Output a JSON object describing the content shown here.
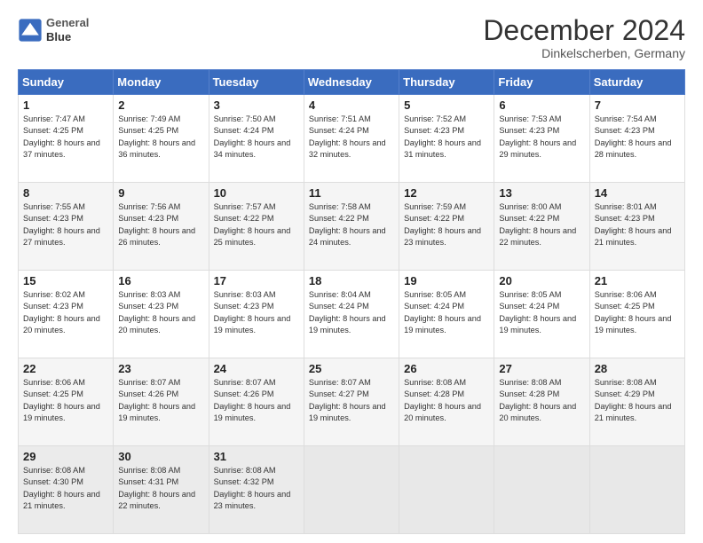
{
  "header": {
    "logo_line1": "General",
    "logo_line2": "Blue",
    "title": "December 2024",
    "subtitle": "Dinkelscherben, Germany"
  },
  "days_of_week": [
    "Sunday",
    "Monday",
    "Tuesday",
    "Wednesday",
    "Thursday",
    "Friday",
    "Saturday"
  ],
  "weeks": [
    [
      {
        "day": "1",
        "rise": "Sunrise: 7:47 AM",
        "set": "Sunset: 4:25 PM",
        "light": "Daylight: 8 hours and 37 minutes."
      },
      {
        "day": "2",
        "rise": "Sunrise: 7:49 AM",
        "set": "Sunset: 4:25 PM",
        "light": "Daylight: 8 hours and 36 minutes."
      },
      {
        "day": "3",
        "rise": "Sunrise: 7:50 AM",
        "set": "Sunset: 4:24 PM",
        "light": "Daylight: 8 hours and 34 minutes."
      },
      {
        "day": "4",
        "rise": "Sunrise: 7:51 AM",
        "set": "Sunset: 4:24 PM",
        "light": "Daylight: 8 hours and 32 minutes."
      },
      {
        "day": "5",
        "rise": "Sunrise: 7:52 AM",
        "set": "Sunset: 4:23 PM",
        "light": "Daylight: 8 hours and 31 minutes."
      },
      {
        "day": "6",
        "rise": "Sunrise: 7:53 AM",
        "set": "Sunset: 4:23 PM",
        "light": "Daylight: 8 hours and 29 minutes."
      },
      {
        "day": "7",
        "rise": "Sunrise: 7:54 AM",
        "set": "Sunset: 4:23 PM",
        "light": "Daylight: 8 hours and 28 minutes."
      }
    ],
    [
      {
        "day": "8",
        "rise": "Sunrise: 7:55 AM",
        "set": "Sunset: 4:23 PM",
        "light": "Daylight: 8 hours and 27 minutes."
      },
      {
        "day": "9",
        "rise": "Sunrise: 7:56 AM",
        "set": "Sunset: 4:23 PM",
        "light": "Daylight: 8 hours and 26 minutes."
      },
      {
        "day": "10",
        "rise": "Sunrise: 7:57 AM",
        "set": "Sunset: 4:22 PM",
        "light": "Daylight: 8 hours and 25 minutes."
      },
      {
        "day": "11",
        "rise": "Sunrise: 7:58 AM",
        "set": "Sunset: 4:22 PM",
        "light": "Daylight: 8 hours and 24 minutes."
      },
      {
        "day": "12",
        "rise": "Sunrise: 7:59 AM",
        "set": "Sunset: 4:22 PM",
        "light": "Daylight: 8 hours and 23 minutes."
      },
      {
        "day": "13",
        "rise": "Sunrise: 8:00 AM",
        "set": "Sunset: 4:22 PM",
        "light": "Daylight: 8 hours and 22 minutes."
      },
      {
        "day": "14",
        "rise": "Sunrise: 8:01 AM",
        "set": "Sunset: 4:23 PM",
        "light": "Daylight: 8 hours and 21 minutes."
      }
    ],
    [
      {
        "day": "15",
        "rise": "Sunrise: 8:02 AM",
        "set": "Sunset: 4:23 PM",
        "light": "Daylight: 8 hours and 20 minutes."
      },
      {
        "day": "16",
        "rise": "Sunrise: 8:03 AM",
        "set": "Sunset: 4:23 PM",
        "light": "Daylight: 8 hours and 20 minutes."
      },
      {
        "day": "17",
        "rise": "Sunrise: 8:03 AM",
        "set": "Sunset: 4:23 PM",
        "light": "Daylight: 8 hours and 19 minutes."
      },
      {
        "day": "18",
        "rise": "Sunrise: 8:04 AM",
        "set": "Sunset: 4:24 PM",
        "light": "Daylight: 8 hours and 19 minutes."
      },
      {
        "day": "19",
        "rise": "Sunrise: 8:05 AM",
        "set": "Sunset: 4:24 PM",
        "light": "Daylight: 8 hours and 19 minutes."
      },
      {
        "day": "20",
        "rise": "Sunrise: 8:05 AM",
        "set": "Sunset: 4:24 PM",
        "light": "Daylight: 8 hours and 19 minutes."
      },
      {
        "day": "21",
        "rise": "Sunrise: 8:06 AM",
        "set": "Sunset: 4:25 PM",
        "light": "Daylight: 8 hours and 19 minutes."
      }
    ],
    [
      {
        "day": "22",
        "rise": "Sunrise: 8:06 AM",
        "set": "Sunset: 4:25 PM",
        "light": "Daylight: 8 hours and 19 minutes."
      },
      {
        "day": "23",
        "rise": "Sunrise: 8:07 AM",
        "set": "Sunset: 4:26 PM",
        "light": "Daylight: 8 hours and 19 minutes."
      },
      {
        "day": "24",
        "rise": "Sunrise: 8:07 AM",
        "set": "Sunset: 4:26 PM",
        "light": "Daylight: 8 hours and 19 minutes."
      },
      {
        "day": "25",
        "rise": "Sunrise: 8:07 AM",
        "set": "Sunset: 4:27 PM",
        "light": "Daylight: 8 hours and 19 minutes."
      },
      {
        "day": "26",
        "rise": "Sunrise: 8:08 AM",
        "set": "Sunset: 4:28 PM",
        "light": "Daylight: 8 hours and 20 minutes."
      },
      {
        "day": "27",
        "rise": "Sunrise: 8:08 AM",
        "set": "Sunset: 4:28 PM",
        "light": "Daylight: 8 hours and 20 minutes."
      },
      {
        "day": "28",
        "rise": "Sunrise: 8:08 AM",
        "set": "Sunset: 4:29 PM",
        "light": "Daylight: 8 hours and 21 minutes."
      }
    ],
    [
      {
        "day": "29",
        "rise": "Sunrise: 8:08 AM",
        "set": "Sunset: 4:30 PM",
        "light": "Daylight: 8 hours and 21 minutes."
      },
      {
        "day": "30",
        "rise": "Sunrise: 8:08 AM",
        "set": "Sunset: 4:31 PM",
        "light": "Daylight: 8 hours and 22 minutes."
      },
      {
        "day": "31",
        "rise": "Sunrise: 8:08 AM",
        "set": "Sunset: 4:32 PM",
        "light": "Daylight: 8 hours and 23 minutes."
      },
      null,
      null,
      null,
      null
    ]
  ]
}
